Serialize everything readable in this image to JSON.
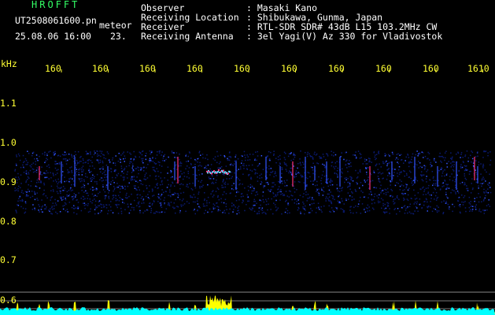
{
  "header": {
    "brand": "HROFFT",
    "file_name": "UT2508061600.pn",
    "mode": "meteor",
    "datetime": "25.08.06 16:00",
    "count": "23."
  },
  "station": [
    {
      "label": "Observer",
      "value": ": Masaki Kano"
    },
    {
      "label": "Receiving Location",
      "value": ": Shibukawa, Gunma, Japan"
    },
    {
      "label": "Receiver",
      "value": ": RTL-SDR SDR# 43dB L15 103.2MHz CW"
    },
    {
      "label": "Receiving Antenna",
      "value": ": 3el Yagi(V) Az 330 for Vladivostok"
    }
  ],
  "chart_data": {
    "type": "heatmap",
    "y_unit": "kHz",
    "x_ticks": [
      "160",
      "160",
      "160",
      "160",
      "160",
      "160",
      "160",
      "160",
      "160",
      "1610"
    ],
    "y_ticks": [
      "1.1",
      "1.0",
      "0.9",
      "0.8",
      "0.7",
      "0.6"
    ],
    "ylim": [
      0.6,
      1.15
    ],
    "signal_band_khz": [
      0.82,
      0.98
    ],
    "head_echo_khz": 0.92,
    "colors": {
      "background": "#000000",
      "noise_low": "#0a1a70",
      "noise_high": "#3355ff",
      "echo": "#ff3377",
      "power_fill": "#ffff00",
      "baseline": "#00ffff",
      "gridline": "#888888"
    }
  },
  "icons": {}
}
